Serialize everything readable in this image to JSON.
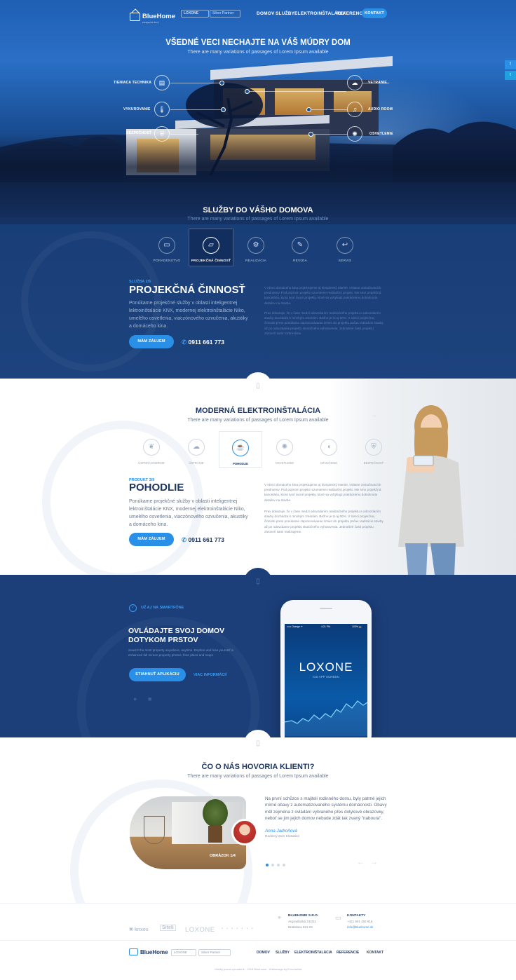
{
  "header": {
    "logo": {
      "name": "BlueHome",
      "sub": "inteligentne domy"
    },
    "partners": [
      "LOXONE",
      "Silver Partner"
    ],
    "nav": [
      "DOMOV",
      "SLUŽBY",
      "ELEKTROINŠTALÁCIA",
      "REFERENCIE"
    ],
    "contact_label": "KONTAKT"
  },
  "social": {
    "facebook": "f",
    "twitter": "t"
  },
  "hero": {
    "title": "VŠEDNÉ VECI NECHAJTE NA VÁŠ MÚDRY DOM",
    "subtitle": "There are many variations of passages of Lorem Ipsum available",
    "hotspots_left": [
      "TIENIACA TECHNIKA",
      "VYKUROVANIE",
      "BEZPEČNOSŤ"
    ],
    "hotspots_right": [
      "VETRANIE",
      "AUDIO ROOM",
      "OSVETLENIE"
    ]
  },
  "services": {
    "title": "SLUŽBY DO VÁŠHO DOMOVA",
    "subtitle": "There are many variations of passages of Lorem Ipsum available",
    "tabs": [
      "PORADENSTVO",
      "PROJEKČNÁ ČINNOSŤ",
      "REALIZÁCIA",
      "REVÍZIA",
      "SERVIS"
    ],
    "active_index": 1,
    "kicker": "SLUŽBA 2/5",
    "heading": "PROJEKČNÁ ČINNOSŤ",
    "text": "Ponúkame projekčné služby v oblasti inteligentnej lektroinštalácie KNX, modernej elektroinštalácie Niko, umelého osvetlenia, viaczónového ozvučenia, akustiky a domáceho kina.",
    "cta": "MÁM ZÁUJEM",
    "phone": "0911 661 773",
    "right_p1": "V rámci domáceho kina projektujeme aj komplexný interiér, vrátane zariaďovacích predmetov. Pod pojmom projekt rozumieme realizačný projekt. Nie sme projekčná kancelária, ktorá tvorí lacné projekty, ktoré sa vyhýbajú praktickému dotiahnutiu detailov na stavbe.",
    "right_p2": "Prax dokazuje, že v čase medzi odovzdaním realizačného projektu a odovzdaním stavby dochádza k mnohým zmenám. Bežne je to aj 50%. V rámci projekčnej činnosti preto ponúkame zapracovávanie zmien do projektu počas realizácie stavby až po odovzdanie projektu skutočného vyhotovenia. Jednotlivé časti projektu zároveň sami rozkreslime."
  },
  "electro": {
    "title": "MODERNÁ ELEKTROINŠTALÁCIA",
    "subtitle": "There are many variations of passages of Lorem Ipsum available",
    "tabs": [
      "ÚSPORA ENERGIE",
      "ÚSTRANIE",
      "POHODLIE",
      "OSVETLENIE",
      "OZVUČENIE",
      "BEZPEČNOSŤ"
    ],
    "active_index": 2,
    "kicker": "PRODUKT 3/9",
    "heading": "POHODLIE",
    "text": "Ponúkame projekčné služby v oblasti inteligentnej lektroinštalácie KNX, modernej elektroinštalácie Niko, umelého osvetlenia, viaczónového ozvučenia, akustiky a domáceho kina.",
    "cta": "MÁM ZÁUJEM",
    "phone": "0911 661 773",
    "right_p1": "V rámci domáceho kina projektujeme aj komplexný interiér, vrátane zariaďovacích predmetov. Pod pojmom projekt rozumieme realizačný projekt. Nie sme projekčná kancelária, ktorá tvorí lacné projekty, ktoré sa vyhýbajú praktickému dotiahnutiu detailov na stavbe.",
    "right_p2": "Prax dokazuje, že v čase medzi odovzdaním realizačného projektu a odovzdaním stavby dochádza k mnohým zmenám. Bežne je to aj 50%. V rámci projekčnej činnosti preto ponúkame zapracovávanie zmien do projektu počas realizácie stavby až po odovzdanie projektu skutočného vyhotovenia. Jednotlivé časti projektu zároveň sami realizujeme."
  },
  "app": {
    "badge": "UŽ AJ NA SMARTFÓNE",
    "heading_line1": "OVLÁDAJTE SVOJ DOMOV",
    "heading_line2": "DOTYKOM PRSTOV",
    "text": "Search the most property anywhere, anytime. Explore and lose yourself in enhanced full screen property photos, floor plans and maps",
    "cta_primary": "STIAHNUŤ APLIKÁCIU",
    "cta_secondary": "VIAC INFORMÁCIÍ",
    "phone": {
      "carrier": "••••• Orange ᯤ",
      "time": "4:21 PM",
      "battery": "100% ▬",
      "brand": "LOXONE",
      "screen_label": "iOS APP SCREEN"
    }
  },
  "testimonials": {
    "title": "ČO O NÁS HOVORIA KLIENTI?",
    "subtitle": "There are many variations of passages of Lorem Ipsum available",
    "image_label": "OBRÁZOK 1/4",
    "quote": "Na první schůzce s majiteli rodinného domu, byly patrné jejich mírné obavy z automatizovaného systému domácnosti. Obavy měl zejména z ovládání vybraného přes dotykové obrazovky, neboť se jim jejich domov nebude zdát tak zvaný \"naboura\".",
    "author": "Anna Jadroňová",
    "author_sub": "Rodinný dom Klosatice",
    "dots_total": 4,
    "dots_active": 1
  },
  "footer": {
    "partners": [
      "knxes",
      "Siteli",
      "LOXONE"
    ],
    "company_title": "BLUEHOME S.R.O.",
    "company_lines": [
      "Argondinská 232/21",
      "Bratislava 821 23"
    ],
    "contact_title": "KONTAKTY",
    "contact_lines": [
      "+421 901 492 916",
      "info@bluehome.sk"
    ],
    "nav": [
      "DOMOV",
      "SLUŽBY",
      "ELEKTROINŠTALÁCIA",
      "REFERENCIE",
      "KONTAKT"
    ],
    "copyright": "Všetky práva vyhradené  ·  2018 Bluehome  ·  Webdesign by Evonushka"
  },
  "colors": {
    "accent": "#2a8fe6",
    "navy": "#1c3f7a",
    "hero_top": "#1f5fb4",
    "heading": "#1e3560"
  }
}
